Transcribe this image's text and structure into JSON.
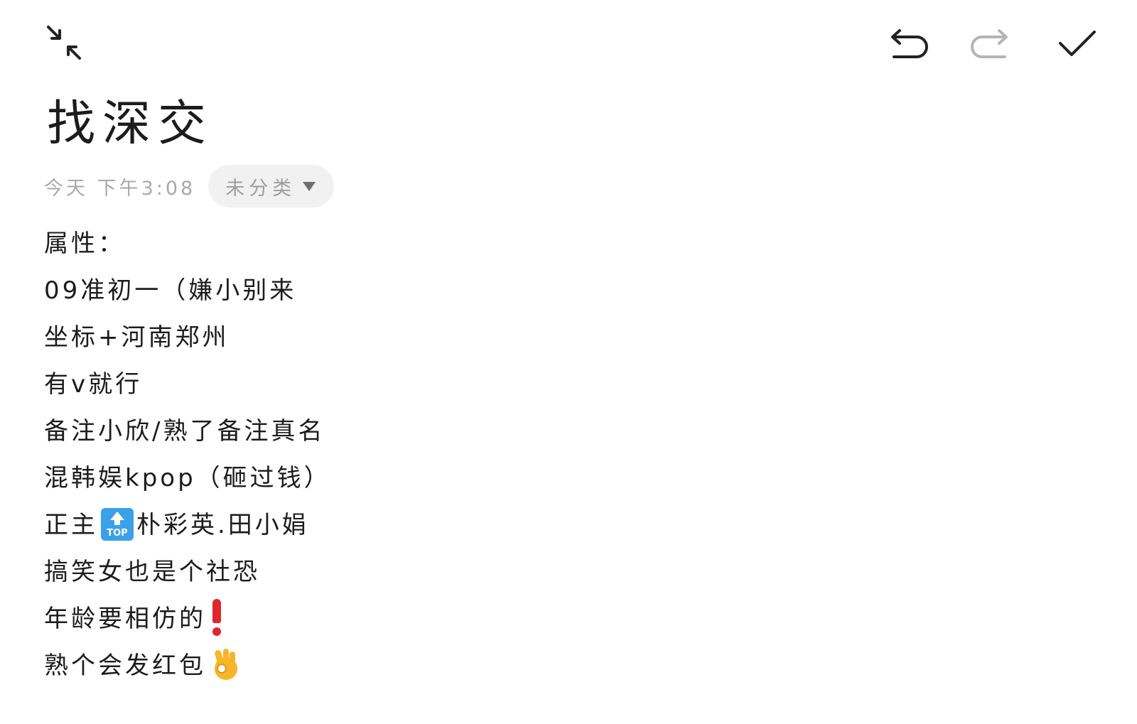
{
  "toolbar": {
    "collapse_icon": "collapse-arrows-icon",
    "undo_icon": "undo-icon",
    "redo_icon": "redo-icon",
    "done_icon": "checkmark-icon"
  },
  "note": {
    "title": "找深交",
    "timestamp": "今天 下午3:08",
    "category": "未分类",
    "lines": [
      "属性：",
      "09准初一（嫌小别来",
      "坐标+河南郑州",
      "有v就行",
      "备注小欣/熟了备注真名",
      "混韩娱kpop（砸过钱）",
      "正主",
      "朴彩英.田小娟",
      "搞笑女也是个社恐",
      "年龄要相仿的",
      "熟个会发红包"
    ],
    "emoji": {
      "top": "TOP"
    }
  },
  "colors": {
    "text": "#1c1c1c",
    "meta": "#a9a9a9",
    "chip_bg": "#f1f1f1",
    "redo_disabled": "#b5b5b5"
  }
}
